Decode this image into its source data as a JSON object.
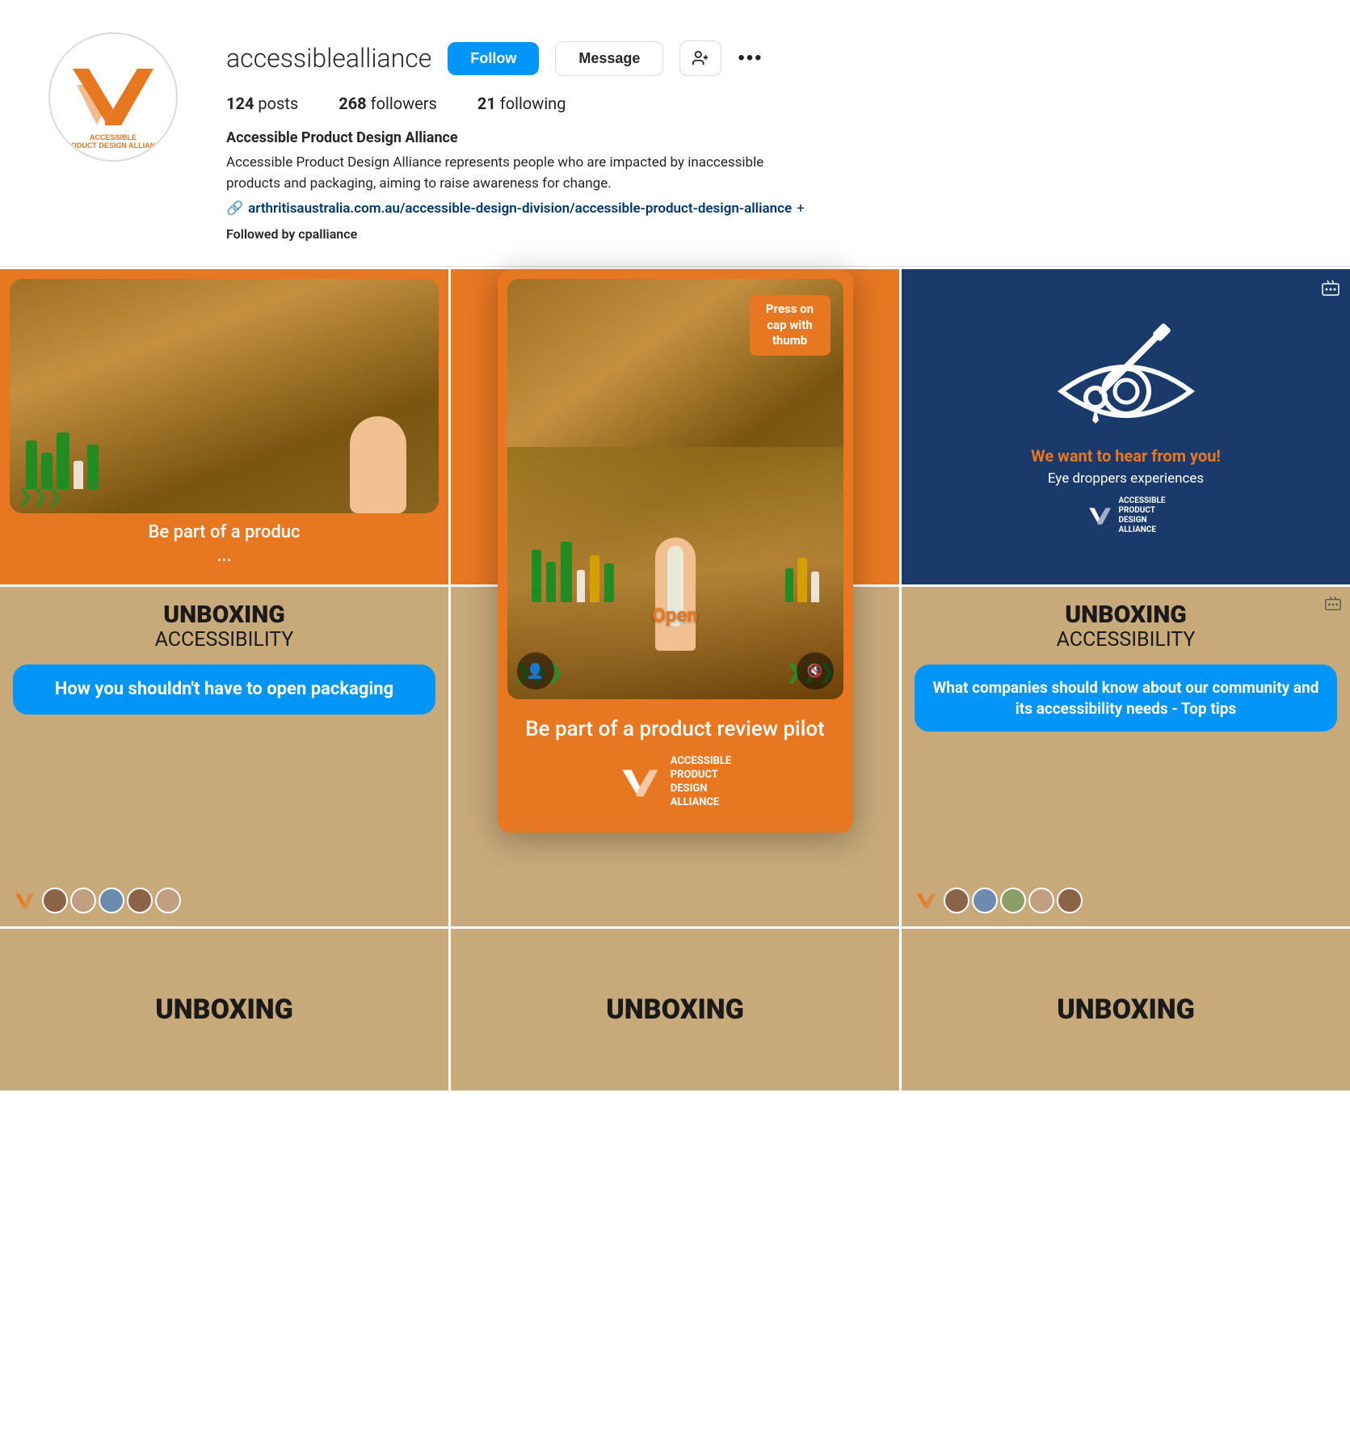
{
  "profile": {
    "username": "accessiblealliance",
    "follow_label": "Follow",
    "message_label": "Message",
    "add_user_icon": "👤+",
    "more_icon": "•••",
    "stats": {
      "posts_count": "124",
      "posts_label": "posts",
      "followers_count": "268",
      "followers_label": "followers",
      "following_count": "21",
      "following_label": "following"
    },
    "bio_name": "Accessible Product Design Alliance",
    "bio_text": "Accessible Product Design Alliance represents people who are impacted by inaccessible products and packaging, aiming to raise awareness for change.",
    "bio_link_icon": "🔗",
    "bio_link_text": "arthritisaustralia.com.au/accessible-design-division/accessible-product-design-alliance",
    "bio_link_plus": "+",
    "followed_by_prefix": "Followed by",
    "followed_by_user": "cpalliance"
  },
  "posts": {
    "row1": [
      {
        "type": "photo_orange",
        "caption": "Be part of a produc..."
      },
      {
        "type": "reel_center_placeholder",
        "caption": ""
      },
      {
        "type": "blue_eyedropper",
        "card_title": "We want to hear from you!",
        "card_subtitle": "Eye droppers experiences",
        "reel_icon": "🎬"
      }
    ],
    "row2": [
      {
        "type": "unboxing",
        "title": "UNBOXING",
        "subtitle": "ACCESSIBILITY",
        "bubble_text": "How you shouldn't have to open packaging"
      },
      {
        "type": "reel_featured",
        "caption": "Be part of a product review pilot",
        "overlay_top": "Press on cap with thumb",
        "overlay_open": "Open"
      },
      {
        "type": "unboxing_right",
        "title": "UNBOXING",
        "subtitle": "ACCESSIBILITY",
        "bubble_text": "What companies should know about our community and its accessibility needs - Top tips",
        "reel_icon": "🎬"
      }
    ],
    "row3": [
      {
        "type": "unboxing_bottom",
        "title": "UNBOXING"
      },
      {
        "type": "unboxing_bottom",
        "title": "UNBOXING"
      },
      {
        "type": "unboxing_bottom",
        "title": "UNBOXING"
      }
    ]
  },
  "logo": {
    "brand_name_line1": "ACCESSIBLE",
    "brand_name_line2": "PRODUCT",
    "brand_name_line3": "DESIGN",
    "brand_name_line4": "ALLIANCE",
    "accent_color": "#E87722"
  },
  "colors": {
    "orange": "#E87722",
    "blue_dark": "#1a3a6b",
    "blue_btn": "#0095f6",
    "tan": "#c8a97a",
    "green": "#2d7a2d",
    "text_dark": "#262626",
    "text_muted": "#8e8e8e",
    "border": "#dbdbdb"
  }
}
